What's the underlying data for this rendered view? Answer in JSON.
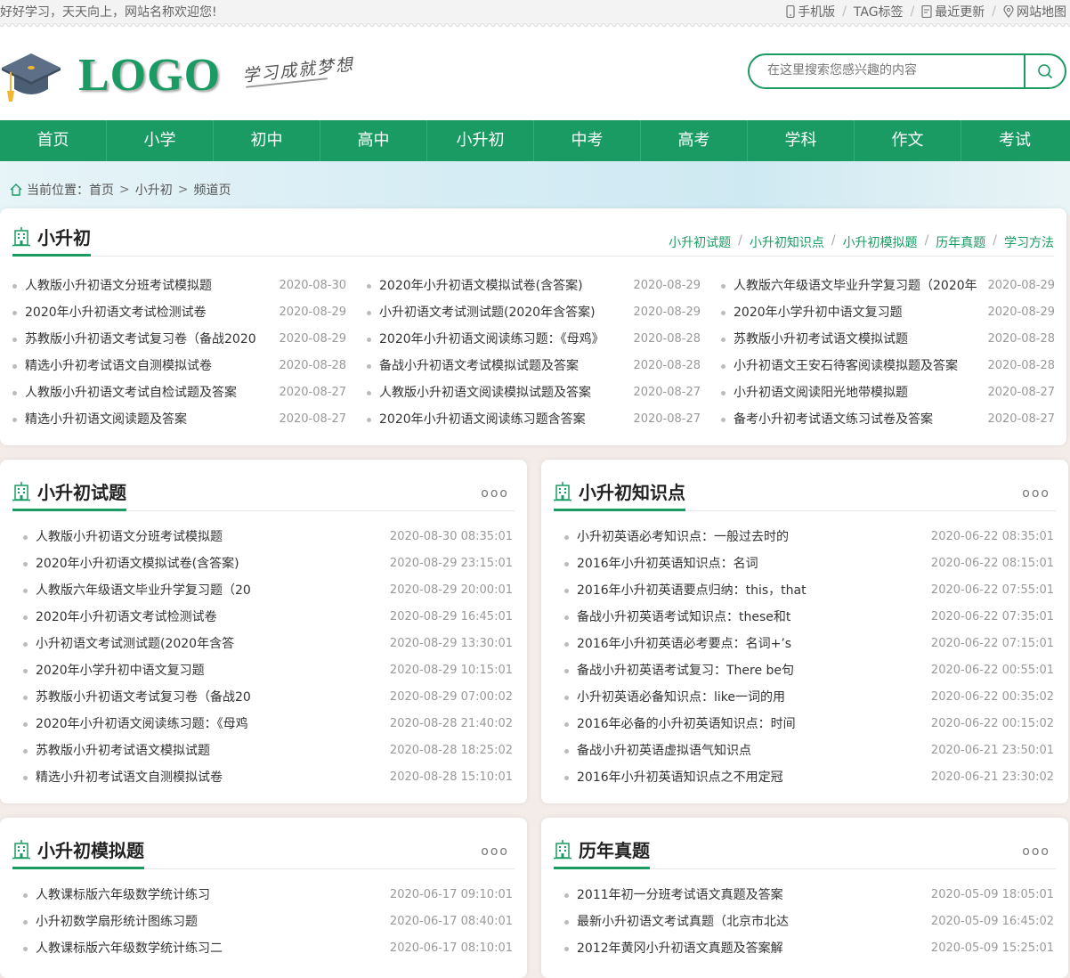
{
  "topbar": {
    "welcome": "好好学习，天天向上，网站名称欢迎您!",
    "links": [
      {
        "label": "手机版",
        "icon": "mobile-icon"
      },
      {
        "label": "TAG标签",
        "icon": ""
      },
      {
        "label": "最近更新",
        "icon": "document-icon"
      },
      {
        "label": "网站地图",
        "icon": "location-icon"
      }
    ]
  },
  "header": {
    "logo_text": "LOGO",
    "slogan": "学习成就梦想",
    "search_placeholder": "在这里搜索您感兴趣的内容"
  },
  "nav": [
    "首页",
    "小学",
    "初中",
    "高中",
    "小升初",
    "中考",
    "高考",
    "学科",
    "作文",
    "考试"
  ],
  "breadcrumb": {
    "prefix": "当前位置：",
    "items": [
      "首页",
      "小升初",
      "频道页"
    ]
  },
  "main_section": {
    "title": "小升初",
    "sublinks": [
      "小升初试题",
      "小升初知识点",
      "小升初模拟题",
      "历年真题",
      "学习方法"
    ],
    "columns": [
      [
        {
          "t": "人教版小升初语文分班考试模拟题",
          "d": "2020-08-30"
        },
        {
          "t": "2020年小升初语文考试检测试卷",
          "d": "2020-08-29"
        },
        {
          "t": "苏教版小升初语文考试复习卷（备战2020",
          "d": "2020-08-29"
        },
        {
          "t": "精选小升初考试语文自测模拟试卷",
          "d": "2020-08-28"
        },
        {
          "t": "人教版小升初语文考试自检试题及答案",
          "d": "2020-08-27"
        },
        {
          "t": "精选小升初语文阅读题及答案",
          "d": "2020-08-27"
        }
      ],
      [
        {
          "t": "2020年小升初语文模拟试卷(含答案)",
          "d": "2020-08-29"
        },
        {
          "t": "小升初语文考试测试题(2020年含答案)",
          "d": "2020-08-29"
        },
        {
          "t": "2020年小升初语文阅读练习题：《母鸡》",
          "d": "2020-08-28"
        },
        {
          "t": "备战小升初语文考试模拟试题及答案",
          "d": "2020-08-28"
        },
        {
          "t": "人教版小升初语文阅读模拟试题及答案",
          "d": "2020-08-27"
        },
        {
          "t": "2020年小升初语文阅读练习题含答案",
          "d": "2020-08-27"
        }
      ],
      [
        {
          "t": "人教版六年级语文毕业升学复习题（2020年",
          "d": "2020-08-29"
        },
        {
          "t": "2020年小学升初中语文复习题",
          "d": "2020-08-29"
        },
        {
          "t": "苏教版小升初考试语文模拟试题",
          "d": "2020-08-28"
        },
        {
          "t": "小升初语文王安石待客阅读模拟题及答案",
          "d": "2020-08-28"
        },
        {
          "t": "小升初语文阅读阳光地带模拟题",
          "d": "2020-08-27"
        },
        {
          "t": "备考小升初考试语文练习试卷及答案",
          "d": "2020-08-27"
        }
      ]
    ]
  },
  "panels": [
    {
      "title": "小升初试题",
      "more": "ooo",
      "items": [
        {
          "t": "人教版小升初语文分班考试模拟题",
          "d": "2020-08-30 08:35:01"
        },
        {
          "t": "2020年小升初语文模拟试卷(含答案)",
          "d": "2020-08-29 23:15:01"
        },
        {
          "t": "人教版六年级语文毕业升学复习题（20",
          "d": "2020-08-29 20:00:01"
        },
        {
          "t": "2020年小升初语文考试检测试卷",
          "d": "2020-08-29 16:45:01"
        },
        {
          "t": "小升初语文考试测试题(2020年含答",
          "d": "2020-08-29 13:30:01"
        },
        {
          "t": "2020年小学升初中语文复习题",
          "d": "2020-08-29 10:15:01"
        },
        {
          "t": "苏教版小升初语文考试复习卷（备战20",
          "d": "2020-08-29 07:00:02"
        },
        {
          "t": "2020年小升初语文阅读练习题：《母鸡",
          "d": "2020-08-28 21:40:02"
        },
        {
          "t": "苏教版小升初考试语文模拟试题",
          "d": "2020-08-28 18:25:02"
        },
        {
          "t": "精选小升初考试语文自测模拟试卷",
          "d": "2020-08-28 15:10:01"
        }
      ]
    },
    {
      "title": "小升初知识点",
      "more": "ooo",
      "items": [
        {
          "t": "小升初英语必考知识点：一般过去时的",
          "d": "2020-06-22 08:35:01"
        },
        {
          "t": "2016年小升初英语知识点：名词",
          "d": "2020-06-22 08:15:01"
        },
        {
          "t": "2016年小升初英语要点归纳：this，that",
          "d": "2020-06-22 07:55:01"
        },
        {
          "t": "备战小升初英语考试知识点：these和t",
          "d": "2020-06-22 07:35:01"
        },
        {
          "t": "2016年小升初英语必考要点：名词+’s",
          "d": "2020-06-22 07:15:01"
        },
        {
          "t": "备战小升初英语考试复习：There be句",
          "d": "2020-06-22 00:55:01"
        },
        {
          "t": "小升初英语必备知识点：like一词的用",
          "d": "2020-06-22 00:35:02"
        },
        {
          "t": "2016年必备的小升初英语知识点：时间",
          "d": "2020-06-22 00:15:02"
        },
        {
          "t": "备战小升初英语虚拟语气知识点",
          "d": "2020-06-21 23:50:01"
        },
        {
          "t": "2016年小升初英语知识点之不用定冠",
          "d": "2020-06-21 23:30:02"
        }
      ]
    },
    {
      "title": "小升初模拟题",
      "more": "ooo",
      "items": [
        {
          "t": "人教课标版六年级数学统计练习",
          "d": "2020-06-17 09:10:01"
        },
        {
          "t": "小升初数学扇形统计图练习题",
          "d": "2020-06-17 08:40:01"
        },
        {
          "t": "人教课标版六年级数学统计练习二",
          "d": "2020-06-17 08:10:01"
        }
      ]
    },
    {
      "title": "历年真题",
      "more": "ooo",
      "items": [
        {
          "t": "2011年初一分班考试语文真题及答案",
          "d": "2020-05-09 18:05:01"
        },
        {
          "t": "最新小升初语文考试真题（北京市北达",
          "d": "2020-05-09 16:45:02"
        },
        {
          "t": "2012年黄冈小升初语文真题及答案解",
          "d": "2020-05-09 15:25:01"
        }
      ]
    }
  ],
  "colors": {
    "brand": "#1a9b63",
    "date": "#999999",
    "background": "#f3ece9"
  }
}
